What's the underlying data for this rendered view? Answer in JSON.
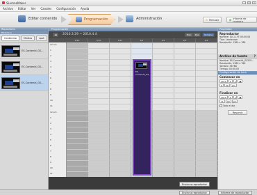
{
  "window": {
    "title": "SLvmneMaker"
  },
  "menu": [
    "Archivo",
    "Editar",
    "Ver",
    "Canales",
    "Configuración",
    "Ayuda"
  ],
  "toolbar": {
    "edit_label": "Editar contenido",
    "schedule_label": "Programación",
    "admin_label": "Administración",
    "message_label": "Mensaje",
    "report_label": "Informe de muestra"
  },
  "left": {
    "header": "Repositorio",
    "subheader": "Biblioteca",
    "tabs": [
      "Contenido",
      "Medios",
      "spot"
    ],
    "items": [
      {
        "label": "ES-Contenid_GS..."
      },
      {
        "label": "ES-Contenid_GS..."
      },
      {
        "label": "ES-Contenid_GS..."
      }
    ]
  },
  "center": {
    "header": "Programación",
    "range": "2010.3.29  ~  2010.4.4",
    "nav": {
      "prev": "Hoy",
      "next": "Día",
      "week": "Semana"
    },
    "days": [
      "3/29",
      "3/30",
      "3/31",
      "4/1",
      "4/2",
      "4/3",
      "4/4"
    ],
    "hours": [
      "12 am",
      "1",
      "2",
      "3",
      "4",
      "5",
      "6",
      "7",
      "8",
      "9",
      "10",
      "11",
      "12 pm",
      "1",
      "2",
      "3",
      "4",
      "5",
      "6",
      "7",
      "8",
      "9",
      "10",
      "11"
    ],
    "event_label": "ES-Contenid_GS",
    "apply_label": "Enviar a reproductor"
  },
  "right": {
    "header": "Propiedad",
    "player_title": "Reproductor",
    "player_name": "Nombre: 00-11-FF-00:00:04",
    "player_type": "Tipo: Landscape",
    "player_res": "Resolución: 1360 x 768",
    "file_title": "Archivo de fuente",
    "file_name": "Nombre: ES-Contenid_GS205...",
    "file_res": "Resolución: 1360 x 768",
    "file_size": "Tamaño: 367KB",
    "file_time": "Tiempo: 00:00:05",
    "config_title": "Configuración de hora",
    "start_title": "Comenzar en",
    "start_date": [
      "2010",
      "4",
      "1"
    ],
    "start_time": [
      "9",
      "00",
      "am"
    ],
    "end_title": "Finalizar en",
    "end_date": [
      "2010",
      "4",
      "1"
    ],
    "end_time": [
      "11",
      "00",
      "pm"
    ],
    "allday_label": "Todo el día",
    "reset_label": "Resumir"
  },
  "status": {
    "send_label": "Enviar a reproductor",
    "report_label": "Informe de reproductor"
  },
  "colors": {
    "accent": "#7f44c2",
    "header": "#7f97b4"
  }
}
